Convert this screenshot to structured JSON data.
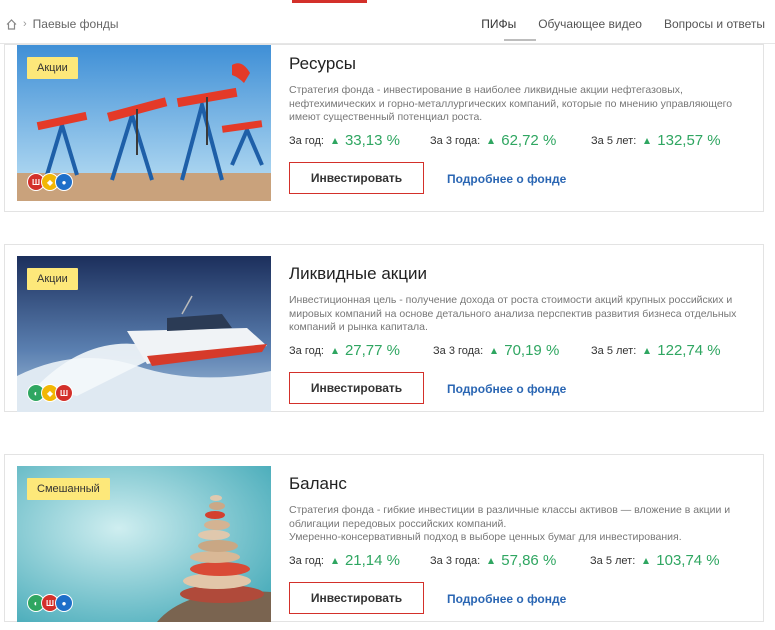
{
  "breadcrumb": {
    "current": "Паевые фонды"
  },
  "nav": {
    "items": [
      "ПИФы",
      "Обучающее видео",
      "Вопросы и ответы"
    ]
  },
  "funds": [
    {
      "badge": "Акции",
      "title": "Ресурсы",
      "description": "Стратегия фонда - инвестирование в наиболее ликвидные акции нефтегазовых, нефтехимических и горно-металлургических компаний, которые по мнению управляющего имеют существенный потенциал роста.",
      "stats": [
        {
          "label": "За год:",
          "value": "33,13 %"
        },
        {
          "label": "За 3 года:",
          "value": "62,72 %"
        },
        {
          "label": "За 5 лет:",
          "value": "132,57 %"
        }
      ],
      "invest_label": "Инвестировать",
      "more_label": "Подробнее о фонде"
    },
    {
      "badge": "Акции",
      "title": "Ликвидные акции",
      "description": "Инвестиционная цель - получение дохода от роста стоимости акций крупных российских и мировых компаний на основе детального анализа перспектив развития бизнеса отдельных компаний и рынка капитала.",
      "stats": [
        {
          "label": "За год:",
          "value": "27,77 %"
        },
        {
          "label": "За 3 года:",
          "value": "70,19 %"
        },
        {
          "label": "За 5 лет:",
          "value": "122,74 %"
        }
      ],
      "invest_label": "Инвестировать",
      "more_label": "Подробнее о фонде"
    },
    {
      "badge": "Смешанный",
      "title": "Баланс",
      "description": "Стратегия фонда - гибкие инвестиции в различные классы активов — вложение в акции и облигации передовых российских компаний.",
      "description2": "Умеренно-консервативный подход в выборе ценных бумаг для инвестирования.",
      "stats": [
        {
          "label": "За год:",
          "value": "21,14 %"
        },
        {
          "label": "За 3 года:",
          "value": "57,86 %"
        },
        {
          "label": "За 5 лет:",
          "value": "103,74 %"
        }
      ],
      "invest_label": "Инвестировать",
      "more_label": "Подробнее о фонде"
    }
  ],
  "colors": {
    "accent": "#d3302a",
    "positive": "#2fa661",
    "link": "#2a66b3",
    "badge": "#fde87a"
  }
}
